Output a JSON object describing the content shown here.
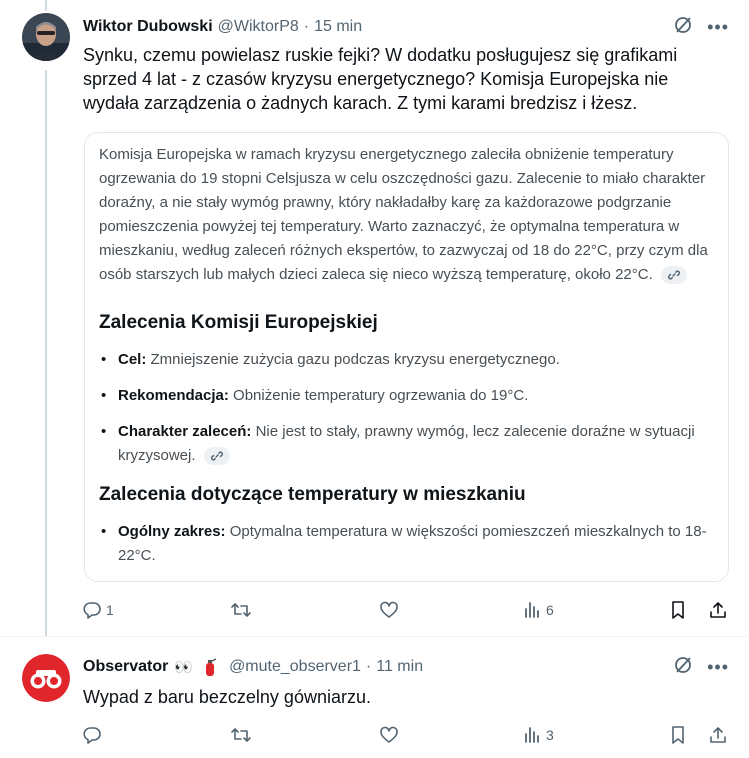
{
  "tweet1": {
    "author_name": "Wiktor Dubowski",
    "author_handle": "@WiktorP8",
    "separator": "·",
    "time": "15 min",
    "text": "Synku, czemu powielasz ruskie fejki? W dodatku posługujesz się grafikami sprzed 4 lat - z czasów kryzysu energetycznego? Komisja Europejska nie wydała zarządzenia o żadnych karach. Z tymi karami bredzisz i łżesz.",
    "card": {
      "paragraph": "Komisja Europejska w ramach kryzysu energetycznego zaleciła obniżenie temperatury ogrzewania do 19 stopni Celsjusza w celu oszczędności gazu. Zalecenie to miało charakter doraźny, a nie stały wymóg prawny, który nakładałby karę za każdorazowe podgrzanie pomieszczenia powyżej tej temperatury. Warto zaznaczyć, że optymalna temperatura w mieszkaniu, według zaleceń różnych ekspertów, to zazwyczaj od 18 do 22°C, przy czym dla osób starszych lub małych dzieci zaleca się nieco wyższą temperaturę, około 22°C.",
      "heading1": "Zalecenia Komisji Europejskiej",
      "list1": [
        {
          "label": "Cel:",
          "text": " Zmniejszenie zużycia gazu podczas kryzysu energetycznego."
        },
        {
          "label": "Rekomendacja:",
          "text": " Obniżenie temperatury ogrzewania do 19°C."
        },
        {
          "label": "Charakter zaleceń:",
          "text": " Nie jest to stały, prawny wymóg, lecz zalecenie doraźne w sytuacji kryzysowej."
        }
      ],
      "heading2": "Zalecenia dotyczące temperatury w mieszkaniu",
      "list2": [
        {
          "label": "Ogólny zakres:",
          "text": " Optymalna temperatura w większości pomieszczeń mieszkalnych to 18-22°C."
        }
      ]
    },
    "actions": {
      "replies": "1",
      "views": "6"
    }
  },
  "tweet2": {
    "author_name": "Observator",
    "author_emoji": "👀",
    "author_handle": "@mute_observer1",
    "separator": "·",
    "time": "11 min",
    "text": "Wypad z baru bezczelny gówniarzu.",
    "actions": {
      "views": "3"
    }
  },
  "colors": {
    "text": "#0f1419",
    "secondary": "#536471",
    "border": "#eff3f4",
    "observator_red": "#e0262b"
  }
}
